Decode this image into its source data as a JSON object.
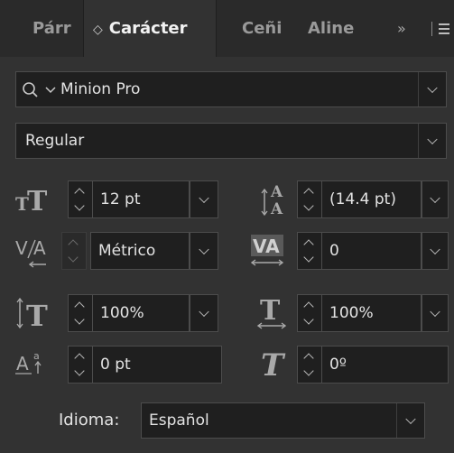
{
  "tabs": {
    "paragraph": "Párr",
    "character": "Carácter",
    "character_prefix": "◇",
    "tab3": "Ceñi",
    "tab4": "Aline",
    "overflow": "»"
  },
  "font": {
    "family": "Minion Pro",
    "style": "Regular"
  },
  "fields": {
    "font_size": "12 pt",
    "leading": "(14.4 pt)",
    "kerning": "Métrico",
    "tracking": "0",
    "vertical_scale": "100%",
    "horizontal_scale": "100%",
    "baseline_shift": "0 pt",
    "rotation": "0º"
  },
  "language": {
    "label": "Idioma:",
    "value": "Español"
  },
  "icons": {
    "search": "search-icon",
    "font_size": "font-size-icon",
    "leading": "leading-icon",
    "kerning": "kerning-icon",
    "tracking": "tracking-icon",
    "vertical_scale": "vertical-scale-icon",
    "horizontal_scale": "horizontal-scale-icon",
    "baseline_shift": "baseline-shift-icon",
    "rotation": "character-rotation-icon"
  },
  "colors": {
    "panel": "#323232",
    "tabbar": "#2a2a2a",
    "field": "#1f1f1f",
    "border": "#4c4c4c",
    "text": "#e3e3e3"
  }
}
